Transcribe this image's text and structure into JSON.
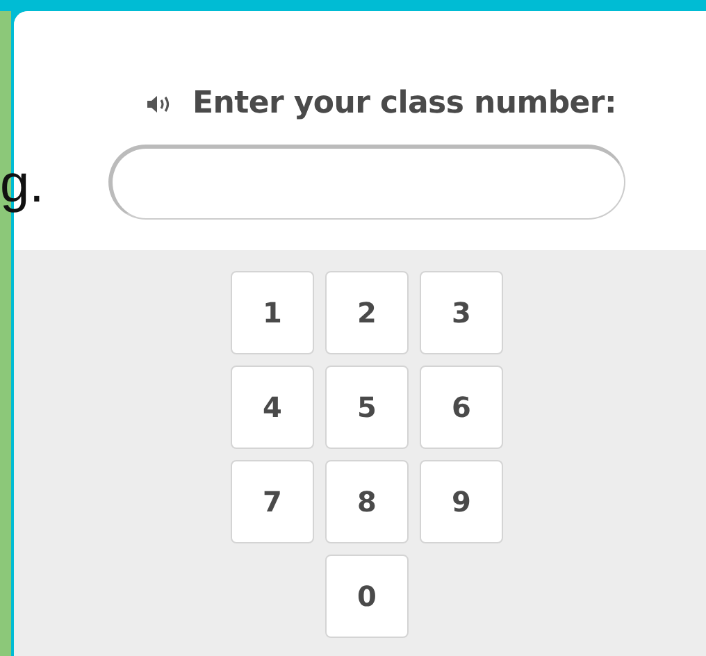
{
  "background_text": "g.",
  "prompt": {
    "label": "Enter your class number:"
  },
  "keypad": {
    "rows": [
      [
        "1",
        "2",
        "3"
      ],
      [
        "4",
        "5",
        "6"
      ],
      [
        "7",
        "8",
        "9"
      ],
      [
        "",
        "0",
        ""
      ]
    ]
  }
}
